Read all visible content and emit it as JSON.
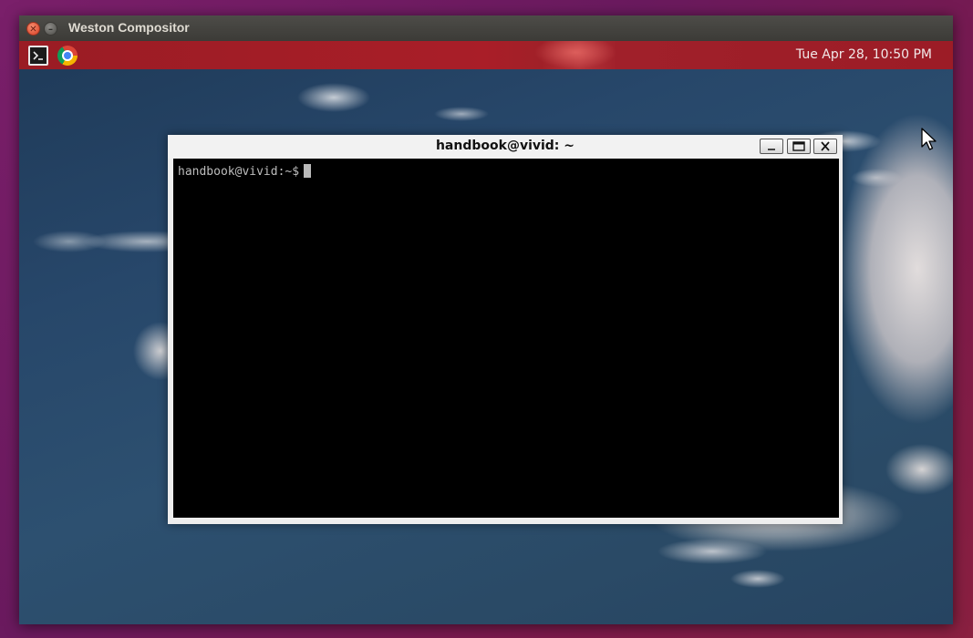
{
  "window": {
    "title": "Weston Compositor",
    "close_icon": "close-icon",
    "minimize_icon": "minimize-icon"
  },
  "panel": {
    "launchers": [
      {
        "name": "terminal",
        "icon": "terminal-icon"
      },
      {
        "name": "chrome",
        "icon": "chrome-icon"
      }
    ],
    "clock": "Tue Apr 28, 10:50 PM",
    "color": "#a51e28"
  },
  "terminal": {
    "title": "handbook@vivid: ~",
    "prompt": "handbook@vivid:~$",
    "buttons": {
      "minimize_icon": "minimize-icon",
      "maximize_icon": "maximize-icon",
      "close_icon": "close-icon"
    }
  }
}
